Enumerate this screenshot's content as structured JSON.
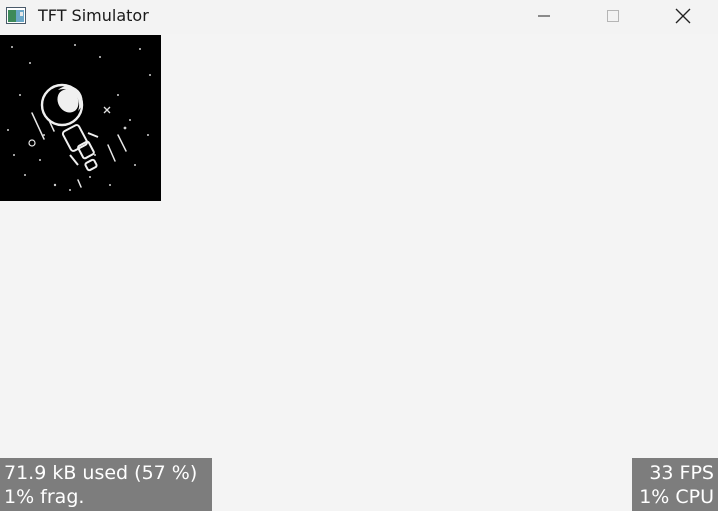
{
  "window": {
    "title": "TFT Simulator",
    "icon": "app-window-icon",
    "controls": {
      "minimize_icon": "minimize-icon",
      "maximize_icon": "maximize-icon",
      "close_icon": "close-icon"
    }
  },
  "canvas": {
    "image": "astronaut-image",
    "background_color": "#f4f4f4"
  },
  "monitor": {
    "memory_used": "71.9 kB used (57 %)",
    "fragmentation": "1% frag.",
    "fps": "33 FPS",
    "cpu": "1% CPU",
    "overlay_color": "#7d7d7d"
  }
}
